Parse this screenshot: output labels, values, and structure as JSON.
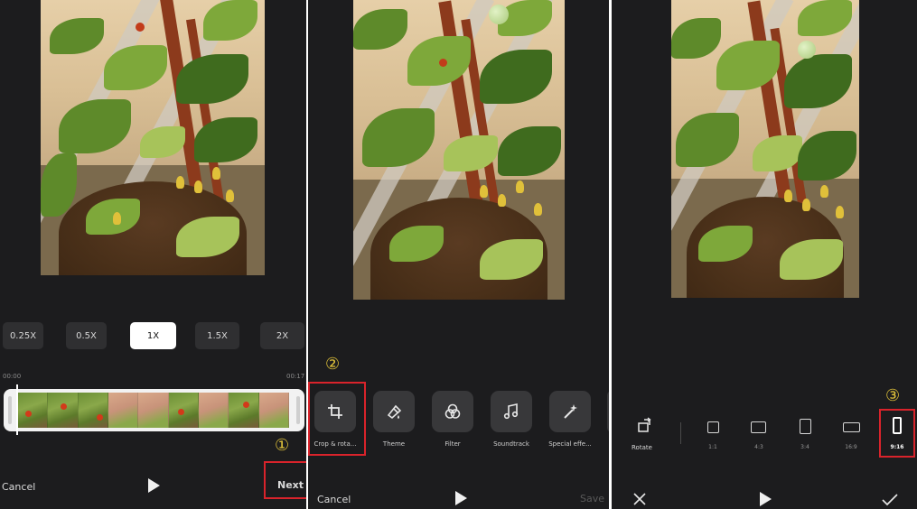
{
  "screen1": {
    "speeds": [
      "0.25X",
      "0.5X",
      "1X",
      "1.5X",
      "2X"
    ],
    "selected_speed": "1X",
    "time_start": "00:00",
    "time_end": "00:17",
    "cancel_label": "Cancel",
    "next_label": "Next",
    "step_marker": "①"
  },
  "screen2": {
    "tools": [
      {
        "label": "Crop & rota...",
        "icon": "crop-icon"
      },
      {
        "label": "Theme",
        "icon": "brush-icon"
      },
      {
        "label": "Filter",
        "icon": "filter-circles-icon"
      },
      {
        "label": "Soundtrack",
        "icon": "music-note-icon"
      },
      {
        "label": "Special effe...",
        "icon": "magic-wand-icon"
      }
    ],
    "cancel_label": "Cancel",
    "save_label": "Save",
    "step_marker": "②"
  },
  "screen3": {
    "rotate_label": "Rotate",
    "ratios": [
      "1:1",
      "4:3",
      "3:4",
      "16:9",
      "9:16"
    ],
    "selected_ratio": "9:16",
    "step_marker": "③"
  },
  "colors": {
    "background": "#1c1c1e",
    "highlight": "#d9232b",
    "marker": "#e0c23a"
  }
}
